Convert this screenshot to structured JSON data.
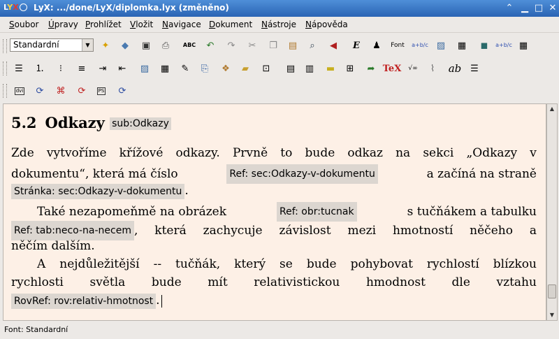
{
  "window": {
    "logo_l": "L",
    "logo_y": "Y",
    "logo_x": "X",
    "title": "LyX: .../done/LyX/diplomka.lyx (změněno)",
    "btn_shade": "⌃",
    "btn_min": "▁",
    "btn_max": "□",
    "btn_close": "✕"
  },
  "menu": [
    {
      "key": "S",
      "rest": "oubor"
    },
    {
      "key": "Ú",
      "rest": "pravy"
    },
    {
      "key": "P",
      "rest": "rohlížet"
    },
    {
      "key": "V",
      "rest": "ložit"
    },
    {
      "key": "N",
      "rest": "avigace"
    },
    {
      "key": "D",
      "rest": "okument"
    },
    {
      "key": "N",
      "rest": "ástroje"
    },
    {
      "key": "N",
      "rest": "ápověda"
    }
  ],
  "toolbar1": {
    "layout_value": "Standardní",
    "spell_label": "ABC",
    "emph_label": "E",
    "font_label": "Font",
    "math_label": "a+b/c"
  },
  "toolbar2": {
    "tex_label": "TeX",
    "ab_label": "ab"
  },
  "toolbar3": {
    "dvi_label": "dvi",
    "ps_label": "PS"
  },
  "document": {
    "section_number": "5.2",
    "section_title": "Odkazy",
    "section_label": "sub:Odkazy",
    "p1_l1": [
      "Zde",
      "vytvoříme",
      "křížové",
      "odkazy.",
      "Prvně",
      "to",
      "bude",
      "odkaz",
      "na",
      "sekci",
      "„Odkazy",
      "v"
    ],
    "p1_l2_a": "dokumentu“, která má číslo",
    "ref1": "Ref: sec:Odkazy-v-dokumentu",
    "p1_l2_b": "a začíná na straně",
    "ref2": "Stránka: sec:Odkazy-v-dokumentu",
    "p1_l3_end": ".",
    "p2_l1_a": "Také nezapomeňmě na obrázek",
    "ref3": "Ref: obr:tucnak",
    "p2_l1_b": "s tučňákem a tabulku",
    "ref4": "Ref: tab:neco-na-necem",
    "p2_l2_b": ", která zachycuje závislost mezi hmotností něčeho a",
    "p2_l3": "něčím dalším.",
    "p3_l1": "A nejdůležitější -- tučňák, který se bude pohybovat rychlostí blízkou",
    "p3_l2": [
      "rychlosti",
      "světla",
      "bude",
      "mít",
      "relativistickou",
      "hmodnost",
      "dle",
      "vztahu"
    ],
    "ref5": "RovRef: rov:relativ-hmotnost",
    "p3_l3_end": "."
  },
  "status": {
    "text": "Font: Standardní"
  },
  "colors": {
    "editor_bg": "#fdf0e6",
    "inset_bg": "#dcd6d0",
    "titlebar": "#3b79c8"
  }
}
